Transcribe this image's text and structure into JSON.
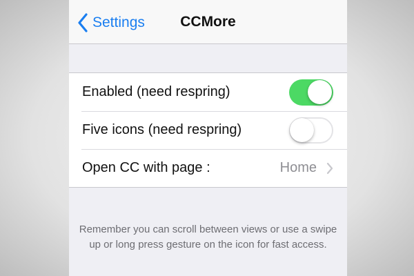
{
  "nav": {
    "back_label": "Settings",
    "title": "CCMore"
  },
  "settings": {
    "rows": [
      {
        "label": "Enabled (need respring)",
        "type": "toggle",
        "on": true
      },
      {
        "label": "Five icons (need respring)",
        "type": "toggle",
        "on": false
      },
      {
        "label": "Open CC with page :",
        "type": "disclosure",
        "value": "Home"
      }
    ]
  },
  "footer": {
    "text": "Remember you can scroll between views or use a swipe up or long press gesture on the icon for fast access."
  },
  "colors": {
    "accent": "#1a7ef0",
    "toggle_on": "#4cd964",
    "background": "#efeff4"
  },
  "icons": {
    "back": "chevron-left-icon",
    "disclosure": "chevron-right-icon"
  }
}
